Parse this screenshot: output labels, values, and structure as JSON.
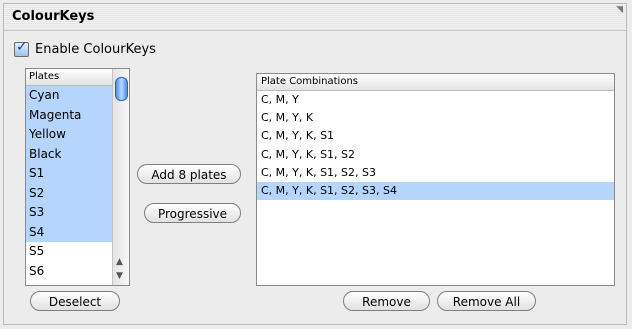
{
  "window": {
    "title": "ColourKeys"
  },
  "enable": {
    "label": "Enable ColourKeys",
    "checked": true
  },
  "plates": {
    "header": "Plates",
    "items": [
      {
        "label": "Cyan",
        "selected": true
      },
      {
        "label": "Magenta",
        "selected": true
      },
      {
        "label": "Yellow",
        "selected": true
      },
      {
        "label": "Black",
        "selected": true
      },
      {
        "label": "S1",
        "selected": true
      },
      {
        "label": "S2",
        "selected": true
      },
      {
        "label": "S3",
        "selected": true
      },
      {
        "label": "S4",
        "selected": true
      },
      {
        "label": "S5",
        "selected": false
      },
      {
        "label": "S6",
        "selected": false
      }
    ]
  },
  "buttons": {
    "add": "Add 8 plates",
    "progressive": "Progressive",
    "deselect": "Deselect",
    "remove": "Remove",
    "remove_all": "Remove All"
  },
  "combinations": {
    "header": "Plate Combinations",
    "items": [
      {
        "label": "C, M, Y",
        "selected": false
      },
      {
        "label": "C, M, Y, K",
        "selected": false
      },
      {
        "label": "C, M, Y, K, S1",
        "selected": false
      },
      {
        "label": "C, M, Y, K, S1, S2",
        "selected": false
      },
      {
        "label": "C, M, Y, K, S1, S2, S3",
        "selected": false
      },
      {
        "label": "C, M, Y, K, S1, S2, S3, S4",
        "selected": true
      }
    ]
  },
  "icons": {
    "corner": "resize-corner-icon",
    "check": "checkmark-icon",
    "scroll_up": "scroll-up-arrow-icon",
    "scroll_down": "scroll-down-arrow-icon"
  },
  "colors": {
    "selection": "#b5d5fc",
    "checkbox_accent": "#1b3c8a"
  }
}
